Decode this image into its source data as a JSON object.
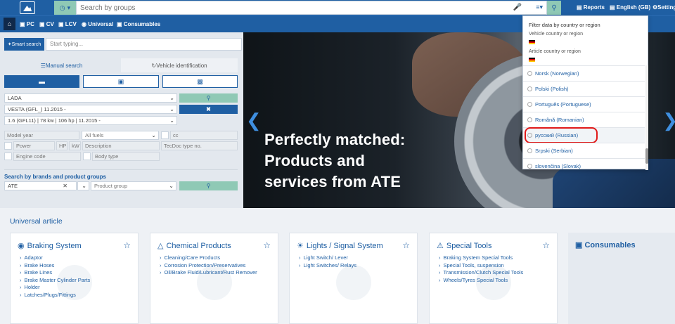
{
  "header": {
    "search_placeholder": "Search by groups",
    "reports_label": "Reports",
    "language_label": "English (GB)",
    "settings_label": "Settings"
  },
  "nav": {
    "items": [
      {
        "label": "PC"
      },
      {
        "label": "CV"
      },
      {
        "label": "LCV"
      },
      {
        "label": "Universal"
      },
      {
        "label": "Consumables"
      }
    ]
  },
  "left_panel": {
    "smart_search_label": "Smart search",
    "smart_search_placeholder": "Start typing...",
    "tab_manual": "Manual search",
    "tab_vehicle": "Vehicle identification",
    "manufacturer": "LADA",
    "model": "VESTA (GFL_) 11.2015 -",
    "engine": "1.6 (GFL11) | 78 kw | 106 hp | 11.2015 -",
    "model_year_placeholder": "Model year",
    "fuel_placeholder": "All fuels",
    "cc_placeholder": "cc",
    "power_placeholder": "Power",
    "hp_label": "HP",
    "kw_label": "kW",
    "description_placeholder": "Description",
    "tecdoc_placeholder": "TecDoc type no.",
    "engine_code_placeholder": "Engine code",
    "body_type_placeholder": "Body type",
    "brands_title": "Search by brands and product groups",
    "brand_value": "ATE",
    "product_group_placeholder": "Product group"
  },
  "banner": {
    "line1": "Perfectly matched:",
    "line2": "Products and",
    "line3": "services from ATE"
  },
  "filter_dropdown": {
    "title": "Filter data by country or region",
    "vehicle_country_label": "Vehicle country or region",
    "article_country_label": "Article country or region",
    "languages": [
      {
        "label": "Norsk (Norwegian)"
      },
      {
        "label": "Polski (Polish)"
      },
      {
        "label": "Português (Portuguese)"
      },
      {
        "label": "Română (Romanian)"
      },
      {
        "label": "русский (Russian)"
      },
      {
        "label": "Srpski (Serbian)"
      },
      {
        "label": "slovenčina (Slovak)"
      }
    ]
  },
  "universal": {
    "title": "Universal article",
    "cards": [
      {
        "title": "Braking System",
        "items": [
          "Adaptor",
          "Brake Hoses",
          "Brake Lines",
          "Brake Master Cylinder Parts",
          "Holder",
          "Latches/Plugs/Fittings"
        ]
      },
      {
        "title": "Chemical Products",
        "items": [
          "Cleaning/Care Products",
          "Corrosion Protection/Preservatives",
          "Oil/Brake Fluid/Lubricant/Rust Remover"
        ]
      },
      {
        "title": "Lights / Signal System",
        "items": [
          "Light Switch/ Lever",
          "Light Switches/ Relays"
        ]
      },
      {
        "title": "Special Tools",
        "items": [
          "Braking System Special Tools",
          "Special Tools, suspension",
          "Transmission/Clutch Special Tools",
          "Wheels/Tyres Special Tools"
        ]
      }
    ],
    "consumables_title": "Consumables"
  },
  "colors": {
    "brand_blue": "#1f5fa3",
    "accent_green": "#8fc9b5",
    "highlight_red": "#e01919"
  }
}
